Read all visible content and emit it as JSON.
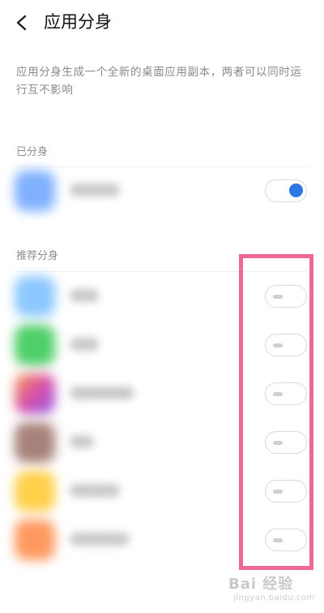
{
  "header": {
    "title": "应用分身",
    "back_icon": "chevron-left-icon"
  },
  "description": "应用分身生成一个全新的桌面应用副本，两者可以同时运行互不影响",
  "cloned_section": {
    "label": "已分身",
    "items": [
      {
        "icon_color": "#7fb0ff",
        "toggle_on": true
      }
    ]
  },
  "recommended_section": {
    "label": "推荐分身",
    "items": [
      {
        "icon_color": "#8cc8ff",
        "toggle_on": false
      },
      {
        "icon_color": "#4fcf6a",
        "toggle_on": false
      },
      {
        "icon_color": "#c97be0",
        "toggle_on": false
      },
      {
        "icon_color": "#a7827a",
        "toggle_on": false
      },
      {
        "icon_color": "#ffd04a",
        "toggle_on": false
      },
      {
        "icon_color": "#ff9960",
        "toggle_on": false
      }
    ]
  },
  "colors": {
    "accent": "#2b78e4",
    "highlight": "#ef6a93"
  },
  "watermark": {
    "text": "Bai 经验",
    "sub": "jingyan.baidu.com"
  }
}
